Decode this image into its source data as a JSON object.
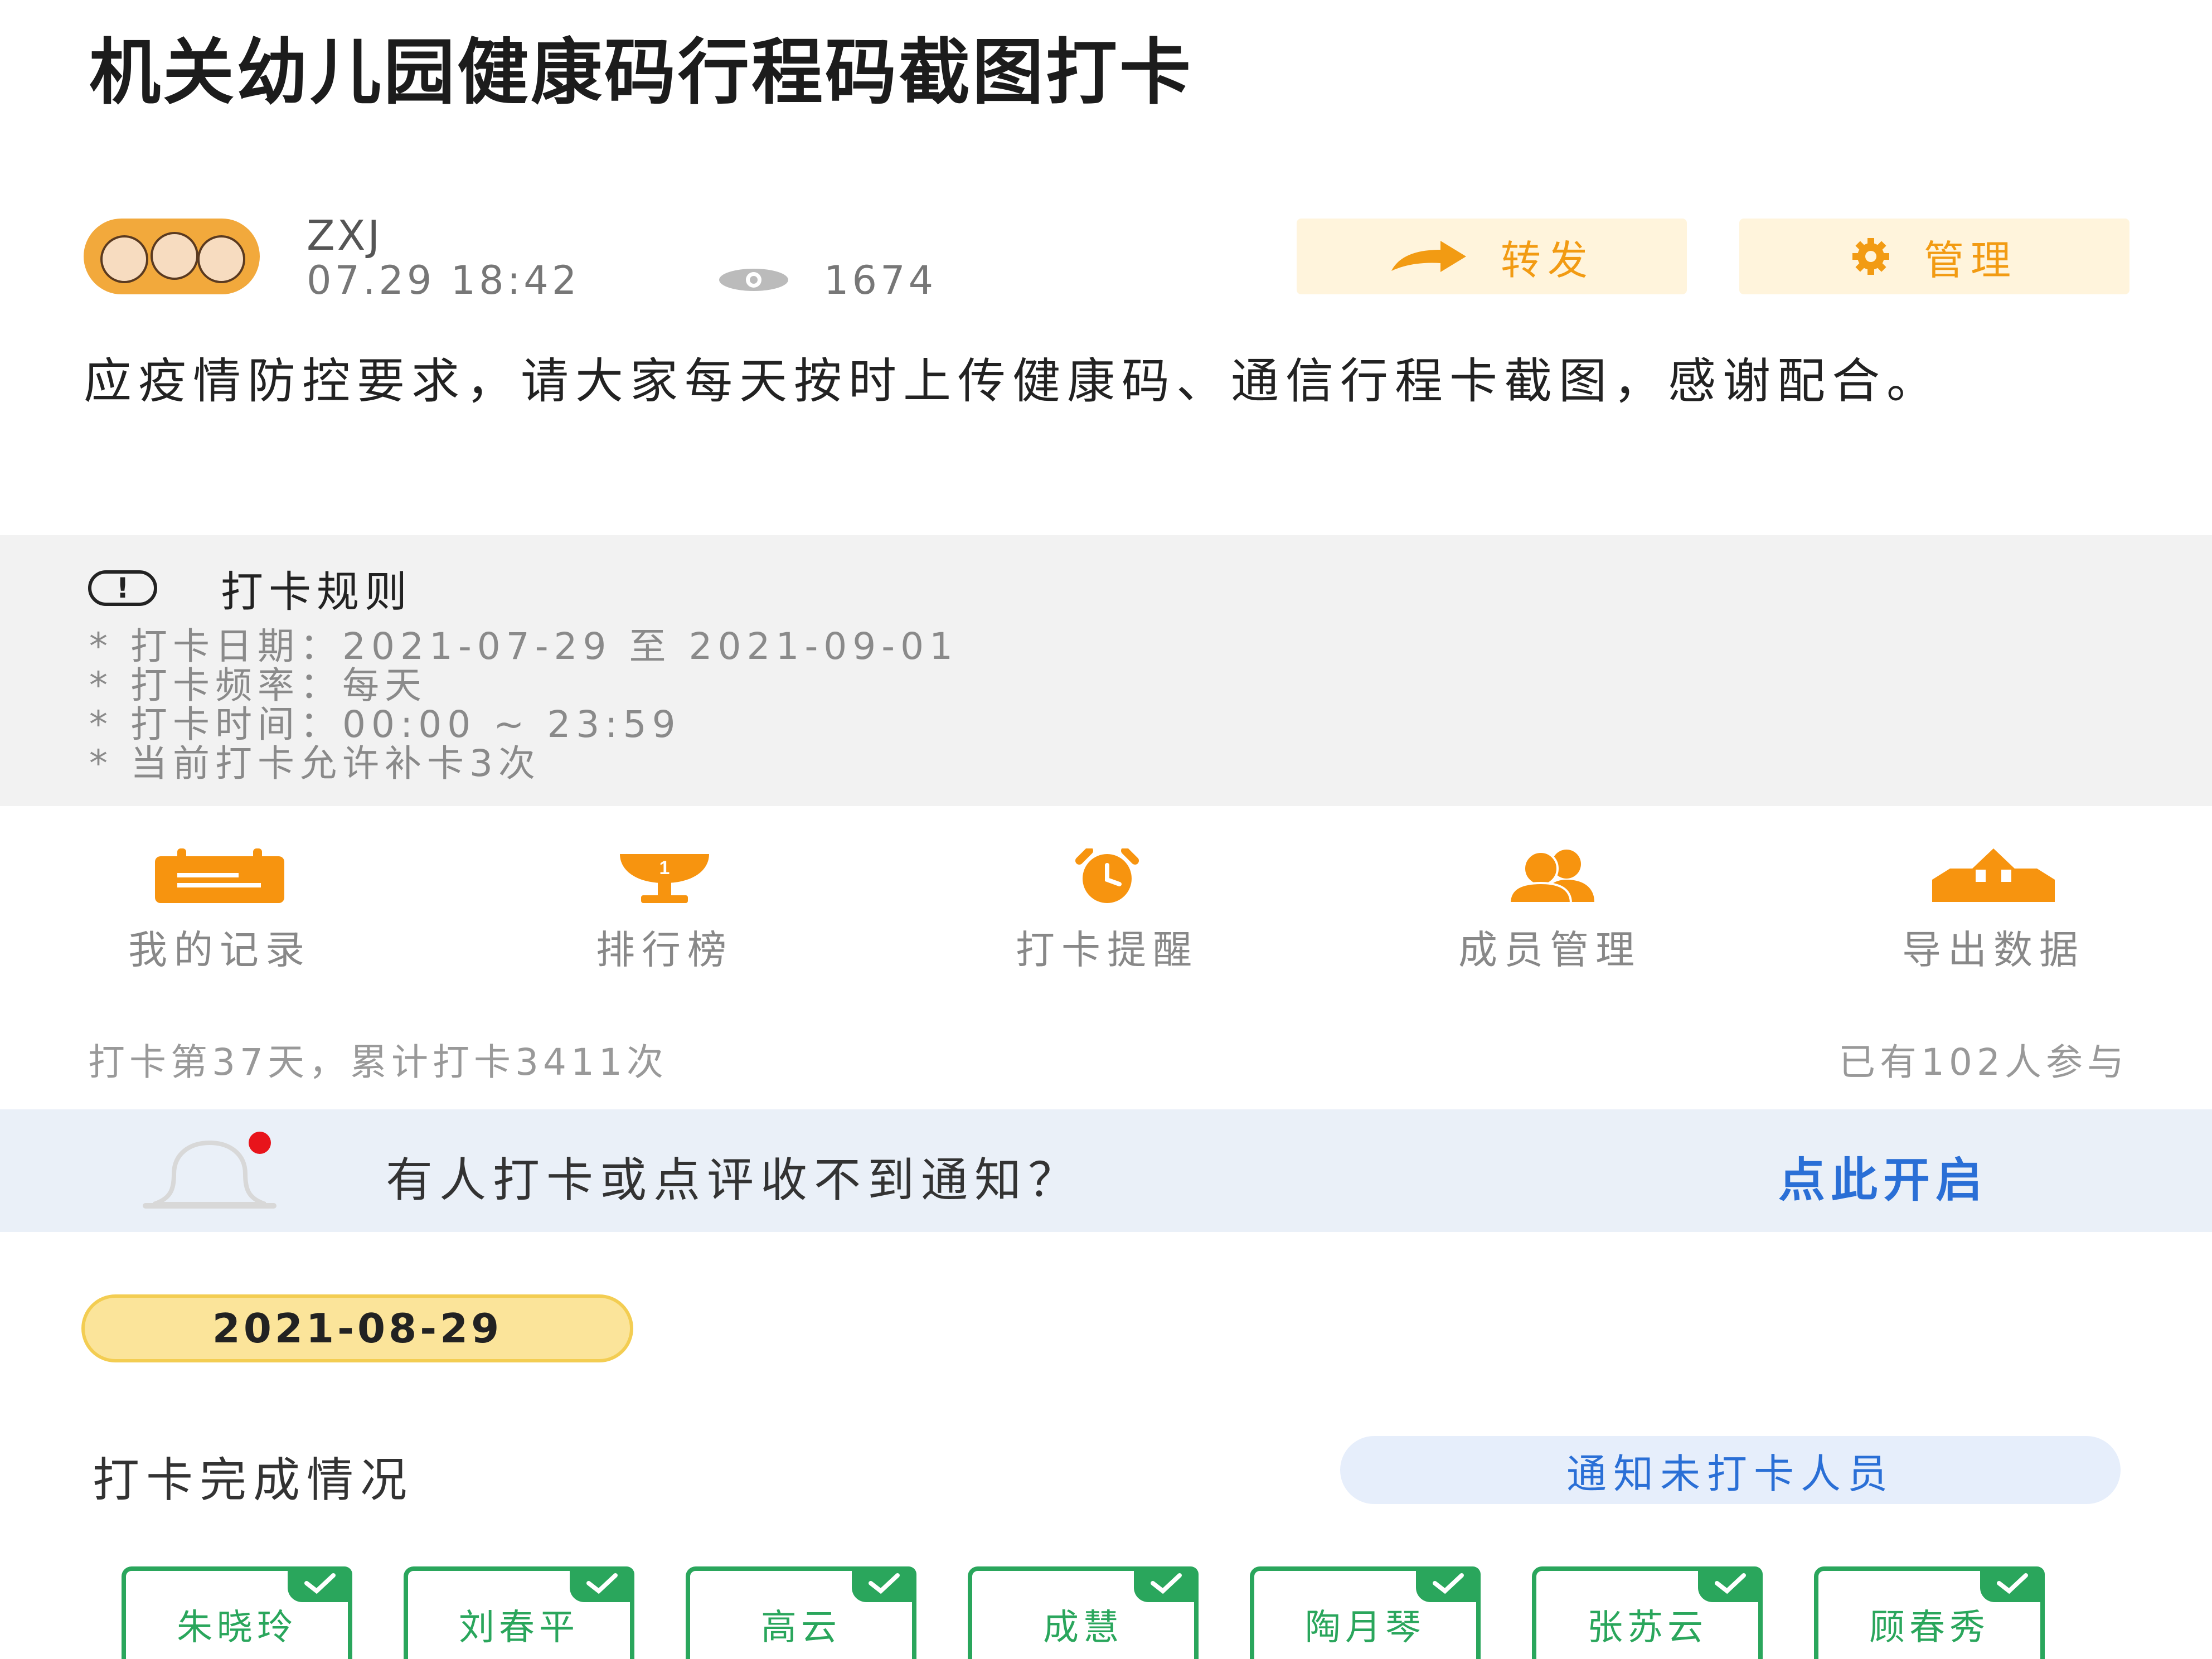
{
  "post": {
    "title": "机关幼儿园健康码行程码截图打卡",
    "author": "ZXJ",
    "datetime": "07.29 18:42",
    "views": "1674",
    "description": "应疫情防控要求，请大家每天按时上传健康码、通信行程卡截图，感谢配合。"
  },
  "actions": {
    "forward_label": "转发",
    "manage_label": "管理"
  },
  "rules": {
    "heading": "打卡规则",
    "lines": [
      "* 打卡日期：2021-07-29 至 2021-09-01",
      "* 打卡频率：每天",
      "* 打卡时间：00:00 ~ 23:59",
      "* 当前打卡允许补卡3次"
    ]
  },
  "grid": {
    "items": [
      {
        "label": "我的记录",
        "icon": "calendar-icon"
      },
      {
        "label": "排行榜",
        "icon": "trophy-icon"
      },
      {
        "label": "打卡提醒",
        "icon": "alarm-clock-icon"
      },
      {
        "label": "成员管理",
        "icon": "people-icon"
      },
      {
        "label": "导出数据",
        "icon": "export-icon"
      }
    ]
  },
  "stats": {
    "progress": "打卡第37天，累计打卡3411次",
    "participants": "已有102人参与"
  },
  "notice": {
    "text": "有人打卡或点评收不到通知？",
    "link": "点此开启"
  },
  "date_pill": "2021-08-29",
  "completion": {
    "title": "打卡完成情况",
    "notify_button": "通知未打卡人员",
    "members": [
      "朱晓玲",
      "刘春平",
      "高云",
      "成慧",
      "陶月琴",
      "张苏云",
      "顾春秀"
    ]
  },
  "colors": {
    "accent_orange": "#f29b13",
    "link_blue": "#2a6fd6",
    "done_green": "#2aa65c",
    "pill_yellow": "#fbe49a"
  }
}
